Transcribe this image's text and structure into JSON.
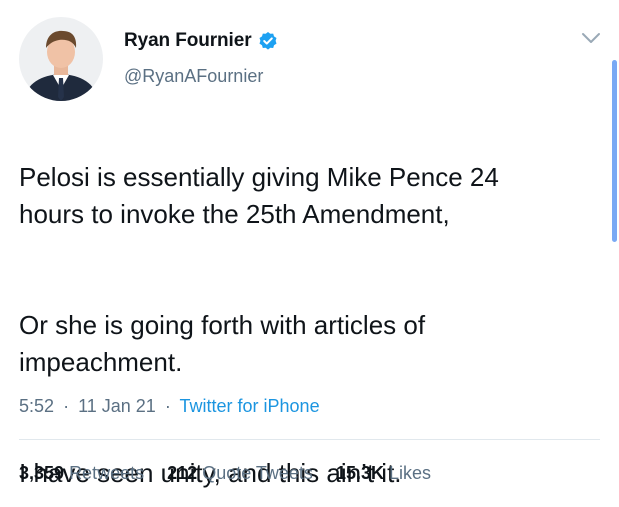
{
  "author": {
    "display_name": "Ryan Fournier",
    "handle": "@RyanAFournier",
    "verified": true
  },
  "tweet": {
    "paragraphs": [
      "Pelosi is essentially giving Mike Pence 24\nhours to invoke the 25th Amendment,",
      "Or she is going forth with articles of\nimpeachment.",
      "I have seen unity, and this ain’t it."
    ],
    "time": "5:52",
    "date": "11 Jan 21",
    "source": "Twitter for iPhone",
    "separator": "·"
  },
  "stats": {
    "retweets_count": "3,359",
    "retweets_label": "Retweets",
    "quote_count": "212",
    "quote_label": "Quote Tweets",
    "likes_count": "15.3K",
    "likes_label": "Likes"
  },
  "colors": {
    "text": "#0f1419",
    "secondary": "#5b7083",
    "link": "#1b95e0",
    "verified": "#1da1f2",
    "divider": "#e1e8ed",
    "scrollbar": "#7aa9f4"
  },
  "icons": {
    "verified": "verified-badge-icon",
    "more": "chevron-down-icon"
  }
}
